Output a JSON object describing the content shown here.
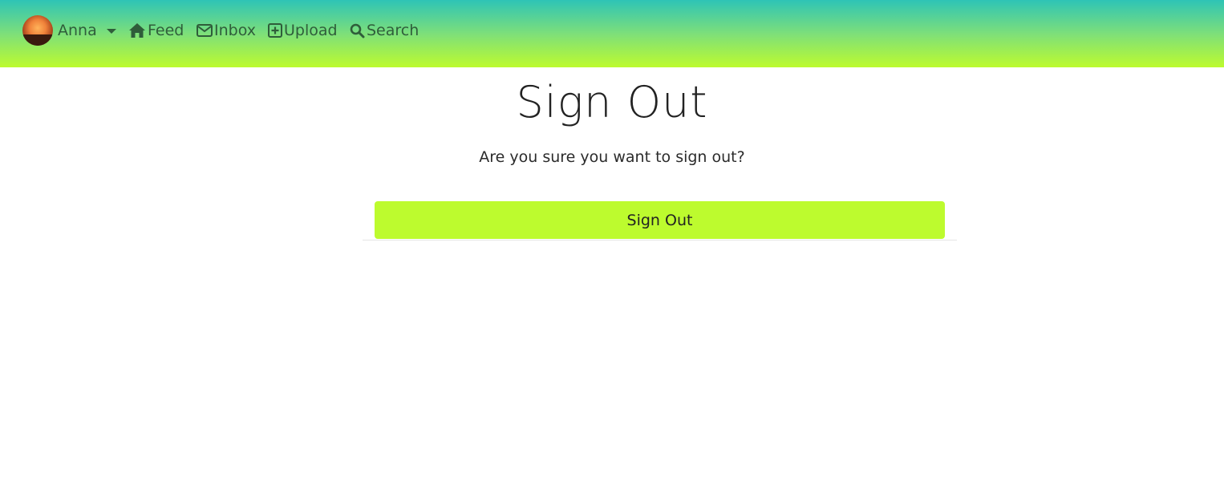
{
  "navbar": {
    "user": {
      "name": "Anna",
      "avatar_icon": "avatar-photo"
    },
    "links": [
      {
        "label": "Feed",
        "icon": "home-icon"
      },
      {
        "label": "Inbox",
        "icon": "envelope-icon"
      },
      {
        "label": "Upload",
        "icon": "plus-square-icon"
      },
      {
        "label": "Search",
        "icon": "search-icon"
      }
    ],
    "colors": {
      "gradient_top": "#2ec4b6",
      "gradient_bottom": "#bdfb2e",
      "link_text": "#2f5d3a"
    }
  },
  "main": {
    "title": "Sign Out",
    "message": "Are you sure you want to sign out?",
    "button_label": "Sign Out",
    "button_color": "#bdfb2e"
  }
}
